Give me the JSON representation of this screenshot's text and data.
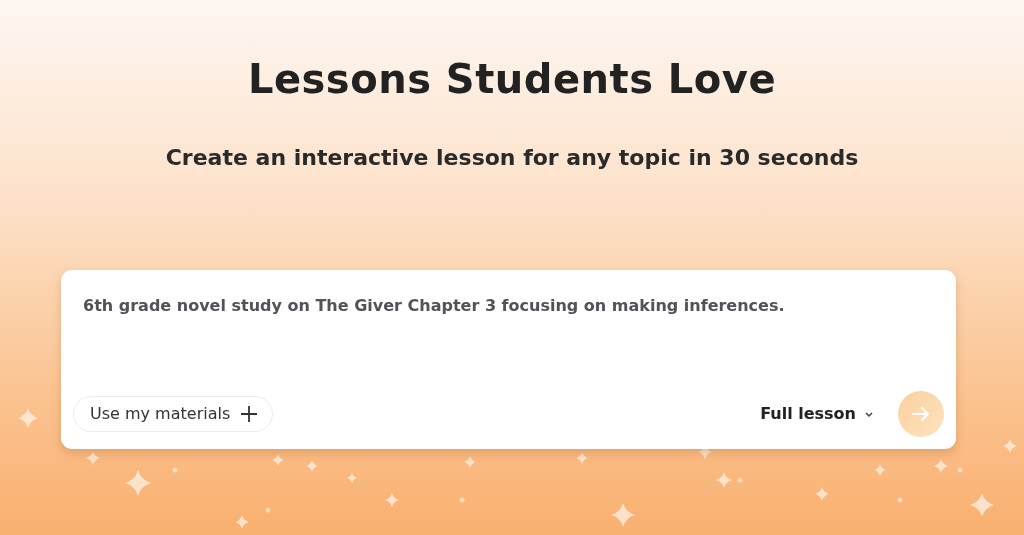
{
  "heading": "Lessons Students Love",
  "subheading": "Create an interactive lesson for any topic in 30 seconds",
  "prompt_box": {
    "value": "6th grade novel study on The Giver Chapter 3 focusing on making inferences.",
    "materials_button": "Use my materials",
    "lesson_type": "Full lesson",
    "submit_disabled": true
  }
}
